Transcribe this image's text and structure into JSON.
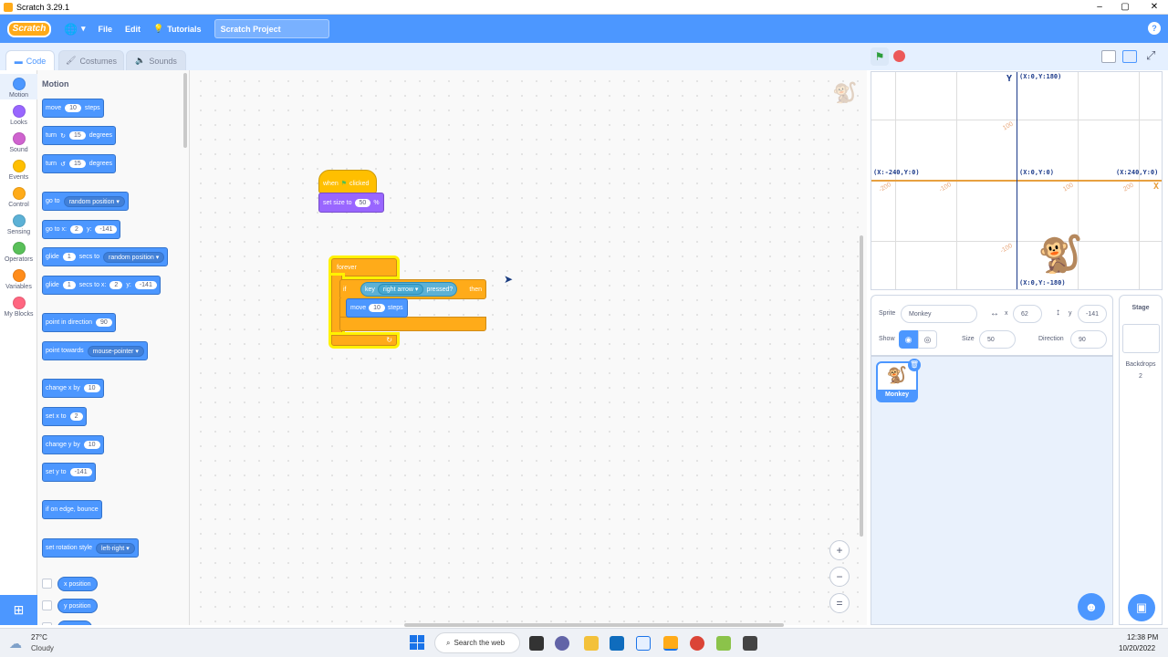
{
  "window": {
    "title": "Scratch 3.29.1",
    "minimize": "–",
    "maximize": "▢",
    "close": "✕"
  },
  "menu": {
    "logo": "Scratch",
    "file": "File",
    "edit": "Edit",
    "tutorials": "Tutorials",
    "project_title": "Scratch Project",
    "help": "?"
  },
  "tabs": {
    "code": "Code",
    "costumes": "Costumes",
    "sounds": "Sounds"
  },
  "categories": [
    {
      "label": "Motion",
      "color": "#4c97ff"
    },
    {
      "label": "Looks",
      "color": "#9966ff"
    },
    {
      "label": "Sound",
      "color": "#cf63cf"
    },
    {
      "label": "Events",
      "color": "#ffbf00"
    },
    {
      "label": "Control",
      "color": "#ffab19"
    },
    {
      "label": "Sensing",
      "color": "#5cb1d6"
    },
    {
      "label": "Operators",
      "color": "#59c059"
    },
    {
      "label": "Variables",
      "color": "#ff8c1a"
    },
    {
      "label": "My Blocks",
      "color": "#ff6680"
    }
  ],
  "palette": {
    "title": "Motion",
    "move": "move",
    "move_val": "10",
    "steps": "steps",
    "turn": "turn",
    "turn_cw_val": "15",
    "turn_ccw_val": "15",
    "degrees": "degrees",
    "goto": "go to",
    "random_position": "random position",
    "goto_x": "go to x:",
    "x_val": "2",
    "y": "y:",
    "y_val": "-141",
    "glide": "glide",
    "glide_val": "1",
    "secs_to": "secs to",
    "secs_to_x": "secs to x:",
    "point_dir": "point in direction",
    "dir_val": "90",
    "point_towards": "point towards",
    "mouse_pointer": "mouse-pointer",
    "change_x": "change x by",
    "change_x_val": "10",
    "set_x": "set x to",
    "set_x_val": "2",
    "change_y": "change y by",
    "change_y_val": "10",
    "set_y": "set y to",
    "set_y_val": "-141",
    "bounce": "if on edge, bounce",
    "rot_style": "set rotation style",
    "left_right": "left-right",
    "x_position": "x position",
    "y_position": "y position"
  },
  "script": {
    "when": "when",
    "clicked": "clicked",
    "set_size": "set size to",
    "size_val": "50",
    "percent": "%",
    "forever": "forever",
    "if": "if",
    "key": "key",
    "right_arrow": "right arrow",
    "pressed": "pressed?",
    "then": "then",
    "move": "move",
    "move_val": "10",
    "steps": "steps"
  },
  "zoom": {
    "in": "+",
    "out": "−",
    "reset": "="
  },
  "stage": {
    "y_axis": "Y",
    "x_axis": "X",
    "top": "(X:0,Y:180)",
    "left": "(X:-240,Y:0)",
    "center": "(X:0,Y:0)",
    "right": "(X:240,Y:0)",
    "bottom": "(X:0,Y:-180)",
    "ticks_x": [
      "-200",
      "-100",
      "100",
      "200"
    ],
    "ticks_y": [
      "100",
      "-100"
    ]
  },
  "sprite_info": {
    "sprite_label": "Sprite",
    "sprite_name": "Monkey",
    "x_label": "x",
    "x_val": "62",
    "y_label": "y",
    "y_val": "-141",
    "show_label": "Show",
    "size_label": "Size",
    "size_val": "50",
    "direction_label": "Direction",
    "direction_val": "90"
  },
  "sprite_list": [
    {
      "name": "Monkey"
    }
  ],
  "stage_panel": {
    "title": "Stage",
    "backdrops": "Backdrops",
    "backdrops_count": "2"
  },
  "taskbar": {
    "temp": "27°C",
    "weather": "Cloudy",
    "search": "Search the web",
    "time": "12:38 PM",
    "date": "10/20/2022"
  }
}
